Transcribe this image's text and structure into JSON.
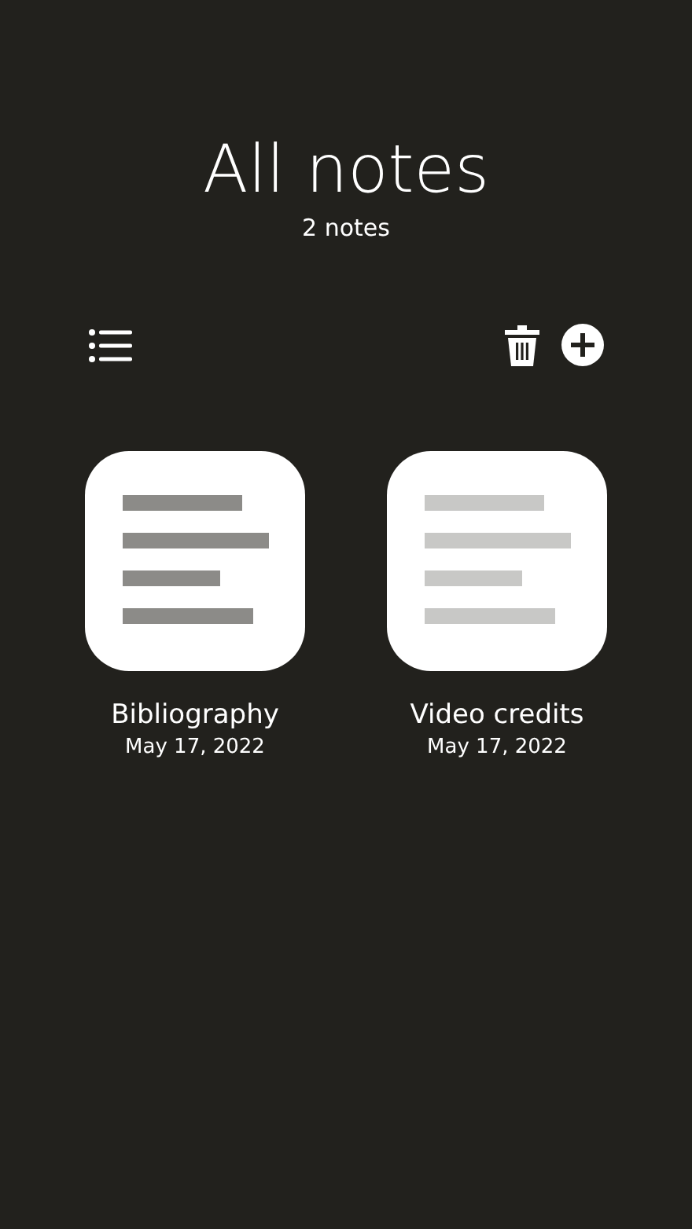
{
  "header": {
    "title": "All notes",
    "count": "2 notes"
  },
  "notes": [
    {
      "title": "Bibliography",
      "date": "May 17, 2022",
      "color": "#8c8b88"
    },
    {
      "title": "Video credits",
      "date": "May 17, 2022",
      "color": "#c8c8c6"
    }
  ]
}
